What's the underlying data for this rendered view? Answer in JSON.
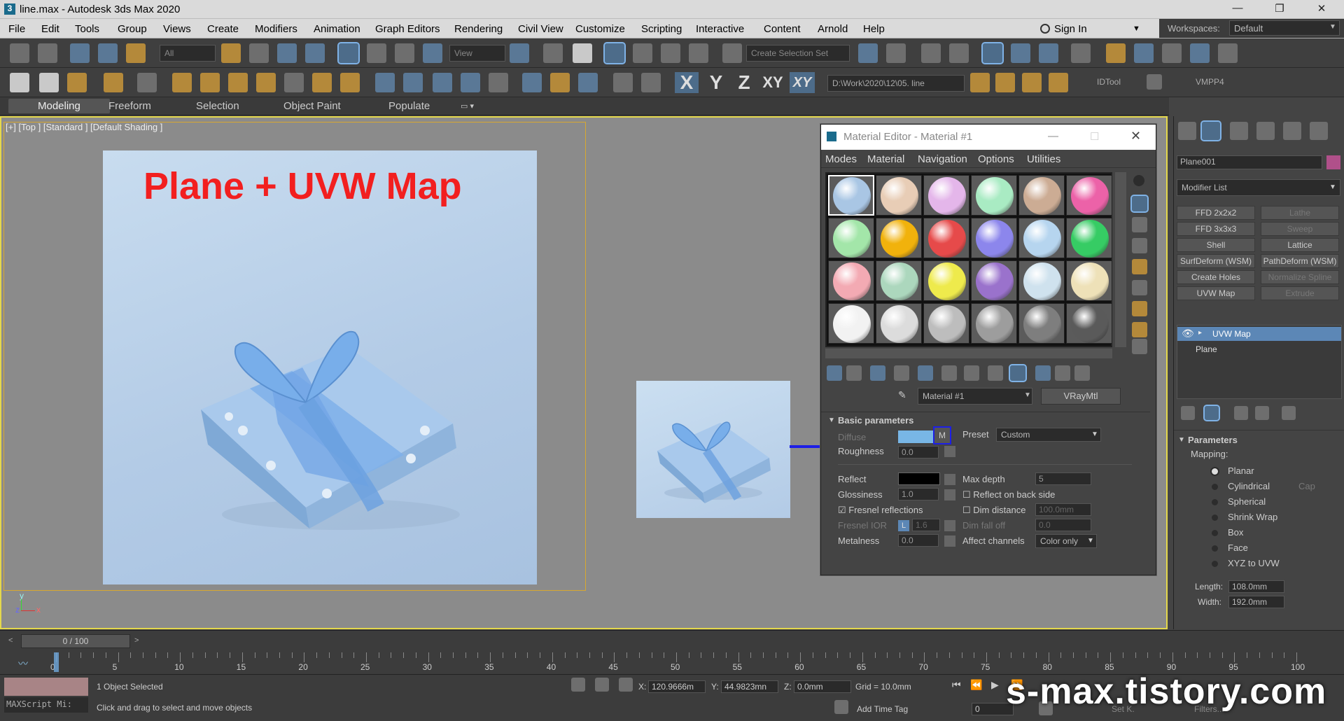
{
  "title": "line.max - Autodesk 3ds Max 2020",
  "window_buttons": {
    "minimize": "—",
    "restore": "❐",
    "close": "✕"
  },
  "menu": [
    "File",
    "Edit",
    "Tools",
    "Group",
    "Views",
    "Create",
    "Modifiers",
    "Animation",
    "Graph Editors",
    "Rendering",
    "Civil View",
    "Customize",
    "Scripting",
    "Interactive",
    "Content",
    "Arnold",
    "Help"
  ],
  "signin": "Sign In",
  "workspaces_label": "Workspaces:",
  "workspaces_value": "Default",
  "toolbar": {
    "filter_all": "All",
    "view_dropdown": "View",
    "selection_set": "Create Selection Set",
    "axis_x": "X",
    "axis_y": "Y",
    "axis_z": "Z",
    "axis_xy": "XY",
    "axis_xy2": "XY",
    "path": "D:\\Work\\2020\\12\\05. line",
    "idtool": "IDTool",
    "vmpp4": "VMPP4"
  },
  "ribbon": [
    "Modeling",
    "Freeform",
    "Selection",
    "Object Paint",
    "Populate"
  ],
  "viewport": {
    "label": "[+] [Top ] [Standard ] [Default Shading ]",
    "title": "Plane + UVW Map",
    "axis_y": "y",
    "axis_x": "x",
    "axis_z": "z"
  },
  "material_editor": {
    "title": "Material Editor - Material #1",
    "menu": [
      "Modes",
      "Material",
      "Navigation",
      "Options",
      "Utilities"
    ],
    "sphere_colors": [
      [
        "#a9c6e4",
        "#e8cdb6",
        "#e4b6ea",
        "#a9ebc3",
        "#ccac94",
        "#ec62a8"
      ],
      [
        "#a3e6a9",
        "#f1b20c",
        "#e64a4a",
        "#8c86ec",
        "#b6d5ef",
        "#36cc64"
      ],
      [
        "#f3aab3",
        "#acd7bd",
        "#eeea4c",
        "#9a72cc",
        "#cfe2ee",
        "#eee1b8"
      ],
      [
        "#f2f2f2",
        "#dcdcdc",
        "#bdbdbd",
        "#9d9d9d",
        "#7e7e7e",
        "#5a5a5a"
      ]
    ],
    "material_name": "Material #1",
    "vraymtl": "VRayMtl",
    "section": "Basic parameters",
    "diffuse": "Diffuse",
    "m_button": "M",
    "preset_label": "Preset",
    "preset_value": "Custom",
    "roughness_label": "Roughness",
    "roughness_value": "0.0",
    "reflect_label": "Reflect",
    "max_depth_label": "Max depth",
    "max_depth_value": "5",
    "glossiness_label": "Glossiness",
    "glossiness_value": "1.0",
    "reflect_back": "Reflect on back side",
    "fresnel": "Fresnel reflections",
    "dim_distance": "Dim distance",
    "dim_distance_value": "100.0mm",
    "fresnel_ior": "Fresnel IOR",
    "ior_lock": "L",
    "ior_value": "1.6",
    "dim_falloff": "Dim fall off",
    "dim_falloff_value": "0.0",
    "metalness_label": "Metalness",
    "metalness_value": "0.0",
    "affect_label": "Affect channels",
    "affect_value": "Color only"
  },
  "command_panel": {
    "object_name": "Plane001",
    "modifier_list": "Modifier List",
    "buttons": [
      {
        "label": "FFD 2x2x2",
        "dim": false
      },
      {
        "label": "Lathe",
        "dim": true
      },
      {
        "label": "FFD 3x3x3",
        "dim": false
      },
      {
        "label": "Sweep",
        "dim": true
      },
      {
        "label": "Shell",
        "dim": false
      },
      {
        "label": "Lattice",
        "dim": false
      },
      {
        "label": "SurfDeform (WSM)",
        "dim": false
      },
      {
        "label": "PathDeform (WSM)",
        "dim": false
      },
      {
        "label": "Create Holes",
        "dim": false
      },
      {
        "label": "Normalize Spline",
        "dim": true
      },
      {
        "label": "UVW Map",
        "dim": false
      },
      {
        "label": "Extrude",
        "dim": true
      }
    ],
    "stack": [
      "UVW Map",
      "Plane"
    ],
    "params_title": "Parameters",
    "mapping_label": "Mapping:",
    "mapping": [
      "Planar",
      "Cylindrical",
      "Spherical",
      "Shrink Wrap",
      "Box",
      "Face",
      "XYZ to UVW"
    ],
    "cap": "Cap",
    "length_label": "Length:",
    "length_value": "108.0mm",
    "width_label": "Width:",
    "width_value": "192.0mm"
  },
  "timeline": {
    "frame": "0 / 100",
    "ticks": [
      "0",
      "5",
      "10",
      "15",
      "20",
      "25",
      "30",
      "35",
      "40",
      "45",
      "50",
      "55",
      "60",
      "65",
      "70",
      "75",
      "80",
      "85",
      "90",
      "95",
      "100"
    ]
  },
  "status": {
    "maxscript": "MAXScript Mi:",
    "selected": "1 Object Selected",
    "prompt": "Click and drag to select and move objects",
    "x_label": "X:",
    "x_value": "120.9666m",
    "y_label": "Y:",
    "y_value": "44.9823mn",
    "z_label": "Z:",
    "z_value": "0.0mm",
    "grid": "Grid = 10.0mm",
    "add_time_tag": "Add Time Tag",
    "frame_input": "0",
    "set_k": "Set K.",
    "filters": "Filters..."
  },
  "watermark": "s-max.tistory.com"
}
